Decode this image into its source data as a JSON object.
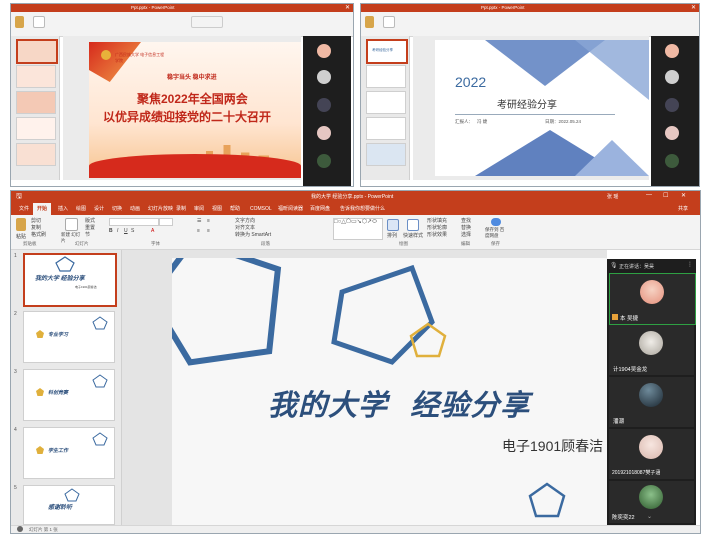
{
  "top_left": {
    "window_title": "Ppt.pptx - PowerPoint",
    "slide_logo_text": "广西民族大学 电子信息工程学院",
    "slide_kicker": "稳字当头 稳中求进",
    "slide_title_line1": "聚焦2022年全国两会",
    "slide_title_line2": "以优异成绩迎接党的二十大召开"
  },
  "top_right": {
    "window_title": "Ppt.pptx - PowerPoint",
    "slide_year": "2022",
    "slide_title": "考研经验分享",
    "slide_reporter": "汇报人：",
    "slide_reporter_name": "冯 婕",
    "slide_date": "日期：2022.05.24",
    "mini_slide_title": "考研经验分享"
  },
  "main": {
    "window_title": "我的大学 经验分享.pptx - PowerPoint",
    "user_name": "张 瑶",
    "share_label": "共享",
    "tabs": [
      "文件",
      "开始",
      "插入",
      "绘图",
      "设计",
      "切换",
      "动画",
      "幻灯片放映",
      "录制",
      "审阅",
      "视图",
      "帮助",
      "COMSOL",
      "福昕阅读器",
      "百度网盘",
      "告诉我你想要做什么"
    ],
    "ribbon": {
      "paste": "粘贴",
      "cut": "剪切",
      "copy": "复制",
      "format_painter": "格式刷",
      "clipboard_group": "剪贴板",
      "new_slide": "新建 幻灯片",
      "layout": "版式",
      "reset": "重置",
      "section": "节",
      "slides_group": "幻灯片",
      "font_group": "字体",
      "paragraph_group": "段落",
      "text_direction": "文字方向",
      "align_text": "对齐文本",
      "convert_smartart": "转换为 SmartArt",
      "arrange": "排列",
      "quick_styles": "快速样式",
      "shape_fill": "形状填充",
      "shape_outline": "形状轮廓",
      "shape_effects": "形状效果",
      "drawing_group": "绘图",
      "find": "查找",
      "replace": "替换",
      "select": "选择",
      "editing_group": "编辑",
      "save_baidu": "保存到 百度网盘",
      "save_group": "保存"
    },
    "slides": [
      {
        "num": "1",
        "title": "我的大学 经验分享",
        "subtitle": "电子1901顾春洁"
      },
      {
        "num": "2",
        "title": "专业学习"
      },
      {
        "num": "3",
        "title": "科创竞赛"
      },
      {
        "num": "4",
        "title": "学生工作"
      },
      {
        "num": "5",
        "title": "感谢聆听"
      }
    ],
    "slide_title": "我的大学  经验分享",
    "slide_subtitle": "电子1901顾春洁",
    "status_text": "幻灯片 第 1 张"
  },
  "meeting": {
    "header": "正在讲话：吴昊",
    "participants": [
      "本 吴捷",
      "计1904吴金龙",
      "潘潮",
      "201921018087樊子涵",
      "陈奕奕22"
    ]
  },
  "colors": {
    "accent": "#c43e1c",
    "slide_blue": "#3b6aa0",
    "slide_gold": "#e0b03c",
    "panel_bg": "#1e1e1e"
  }
}
